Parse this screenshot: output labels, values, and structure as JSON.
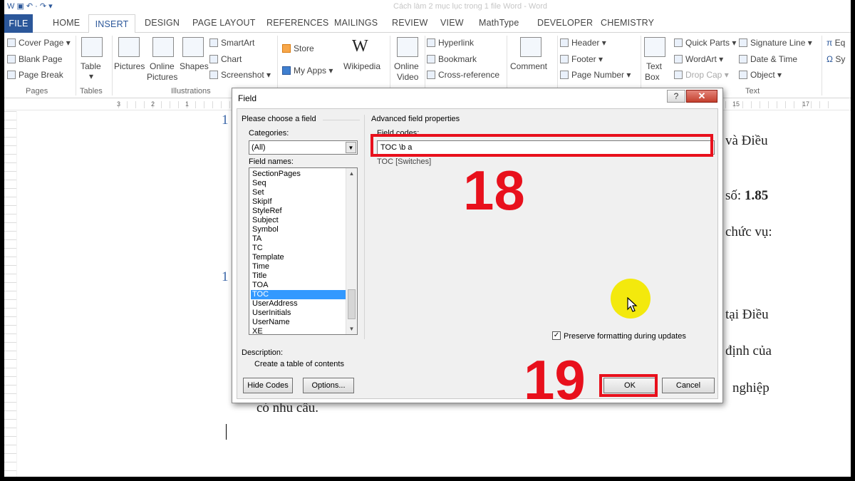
{
  "window": {
    "title": "Cách làm 2 mục lục trong 1 file Word - Word",
    "quick_access": "W ▣ ↶ · ↷ ▾"
  },
  "tabs": [
    "FILE",
    "HOME",
    "INSERT",
    "DESIGN",
    "PAGE LAYOUT",
    "REFERENCES",
    "MAILINGS",
    "REVIEW",
    "VIEW",
    "MathType",
    "DEVELOPER",
    "CHEMISTRY"
  ],
  "ribbon": {
    "pages": {
      "cover_page": "Cover Page",
      "blank_page": "Blank Page",
      "page_break": "Page Break",
      "group": "Pages"
    },
    "tables": {
      "table": "Table",
      "group": "Tables"
    },
    "illustrations": {
      "pictures": "Pictures",
      "online_pictures_1": "Online",
      "online_pictures_2": "Pictures",
      "shapes": "Shapes",
      "smartart": "SmartArt",
      "chart": "Chart",
      "screenshot": "Screenshot",
      "group": "Illustrations"
    },
    "apps": {
      "store": "Store",
      "my_apps": "My Apps",
      "wikipedia": "Wikipedia"
    },
    "media": {
      "online_video_1": "Online",
      "online_video_2": "Video"
    },
    "links": {
      "hyperlink": "Hyperlink",
      "bookmark": "Bookmark",
      "cross_reference": "Cross-reference"
    },
    "comments": {
      "comment": "Comment"
    },
    "header_footer": {
      "header": "Header",
      "footer": "Footer",
      "page_number": "Page Number"
    },
    "text": {
      "text_box_1": "Text",
      "text_box_2": "Box",
      "quick_parts": "Quick Parts",
      "wordart": "WordArt",
      "drop_cap": "Drop Cap",
      "signature_line": "Signature Line",
      "date_time": "Date & Time",
      "object": "Object",
      "group": "Text"
    },
    "symbols": {
      "equation": "Eq",
      "symbol": "Sy"
    }
  },
  "ruler": {
    "left_nums": [
      "3",
      "2",
      "1"
    ],
    "right_nums": [
      "15",
      "17"
    ]
  },
  "document": {
    "t1": "1",
    "t2": "1",
    "r1": "và Điều",
    "r2_prefix": "số: ",
    "r2_bold": "1.85",
    "r3": "chức vụ:",
    "r4": "tại Điều",
    "r5": "định của",
    "r6": "nghiệp",
    "r7": "có nhu cầu."
  },
  "dialog": {
    "title": "Field",
    "left_group": "Please choose a field",
    "categories_label": "Categories:",
    "category_value": "(All)",
    "field_names_label": "Field names:",
    "field_names": [
      "SectionPages",
      "Seq",
      "Set",
      "SkipIf",
      "StyleRef",
      "Subject",
      "Symbol",
      "TA",
      "TC",
      "Template",
      "Time",
      "Title",
      "TOA",
      "TOC",
      "UserAddress",
      "UserInitials",
      "UserName",
      "XE"
    ],
    "selected_field": "TOC",
    "description_label": "Description:",
    "description": "Create a table of contents",
    "right_group": "Advanced field properties",
    "field_codes_label": "Field codes:",
    "field_codes_value": "TOC \\b a",
    "syntax": "TOC [Switches]",
    "preserve_label": "Preserve formatting during updates",
    "preserve_checked": true,
    "hide_codes": "Hide Codes",
    "options": "Options...",
    "ok": "OK",
    "cancel": "Cancel",
    "help": "?",
    "close": "✕"
  },
  "annotations": {
    "step_a": "18",
    "step_b": "19",
    "color": "#e8101c"
  }
}
